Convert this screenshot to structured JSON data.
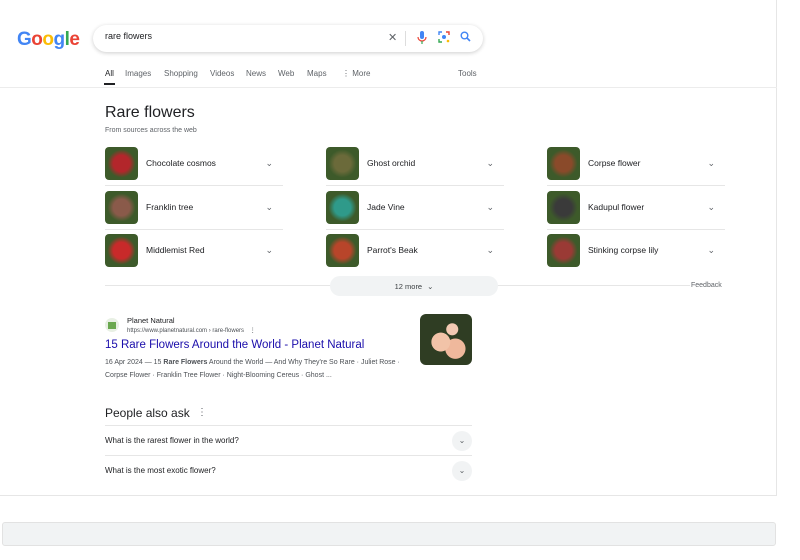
{
  "logo": {
    "text": "Google",
    "letters": [
      [
        "G",
        "#4285f4"
      ],
      [
        "o",
        "#ea4335"
      ],
      [
        "o",
        "#fbbc05"
      ],
      [
        "g",
        "#4285f4"
      ],
      [
        "l",
        "#34a853"
      ],
      [
        "e",
        "#ea4335"
      ]
    ]
  },
  "search": {
    "query": "rare flowers"
  },
  "tabs": [
    "All",
    "Images",
    "Shopping",
    "Videos",
    "News",
    "Web",
    "Maps",
    "⋮ More"
  ],
  "tools": "Tools",
  "section": {
    "title": "Rare flowers",
    "subtitle": "From sources across the web",
    "items": [
      {
        "label": "Chocolate cosmos",
        "color": "#b3262b"
      },
      {
        "label": "Ghost orchid",
        "color": "#6b6a3a"
      },
      {
        "label": "Corpse flower",
        "color": "#8a4a2a"
      },
      {
        "label": "Franklin tree",
        "color": "#8a5a4a"
      },
      {
        "label": "Jade Vine",
        "color": "#2f9a8a"
      },
      {
        "label": "Kadupul flower",
        "color": "#3a3a3a"
      },
      {
        "label": "Middlemist Red",
        "color": "#c82a2a"
      },
      {
        "label": "Parrot's Beak",
        "color": "#b8452a"
      },
      {
        "label": "Stinking corpse lily",
        "color": "#9a3a35"
      }
    ],
    "more_label": "12 more",
    "feedback": "Feedback"
  },
  "result": {
    "site": "Planet Natural",
    "url": "https://www.planetnatural.com › rare-flowers",
    "title": "15 Rare Flowers Around the World - Planet Natural",
    "snippet_pre": "16 Apr 2024 — 15 ",
    "snippet_bold": "Rare Flowers",
    "snippet_post": " Around the World — And Why They're So Rare · Juliet Rose · Corpse Flower · Franklin Tree Flower · Night-Blooming Cereus · Ghost ..."
  },
  "paa": {
    "title": "People also ask",
    "questions": [
      "What is the rarest flower in the world?",
      "What is the most exotic flower?"
    ]
  }
}
